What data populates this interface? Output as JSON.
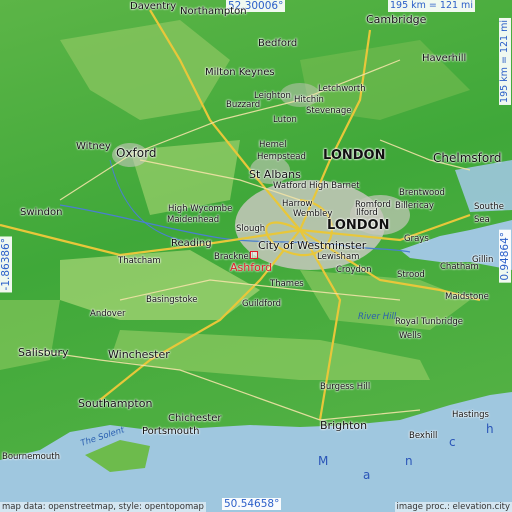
{
  "coords": {
    "top_lat": "52.30006°",
    "bottom_lat": "50.54658°",
    "left_lon": "-1.86386°",
    "right_lon": "0.94864°"
  },
  "scale": {
    "top": "195 km = 121 mi",
    "right": "195 km = 121 mi"
  },
  "credits": {
    "left": "map data: openstreetmap, style: opentopomap",
    "right": "image proc.: elevation.city"
  },
  "marker_label": "Ashford",
  "big_label": "LONDON",
  "cities": {
    "daventry": "Daventry",
    "northampton": "Northampton",
    "cambridge": "Cambridge",
    "bedford": "Bedford",
    "haverhill": "Haverhill",
    "milton_keynes": "Milton Keynes",
    "buzzard": "Buzzard",
    "letchworth": "Letchworth",
    "hitchin": "Hitchin",
    "leighton": "Leighton",
    "stevenage": "Stevenage",
    "luton": "Luton",
    "witney": "Witney",
    "oxford": "Oxford",
    "hemel": "Hemel",
    "hempstead": "Hempstead",
    "chelmsford": "Chelmsford",
    "st_albans": "St Albans",
    "watford": "Watford",
    "high_barnet": "High Barnet",
    "brentwood": "Brentwood",
    "high_wycombe": "High Wycombe",
    "harrow": "Harrow",
    "romford": "Romford",
    "billericay": "Billericay",
    "southend": "Southe",
    "swindon": "Swindon",
    "maidenhead": "Maidenhead",
    "wembley": "Wembley",
    "ilford": "Ilford",
    "sea_label": "Sea",
    "slough": "Slough",
    "reading": "Reading",
    "city_westminster": "City of Westminster",
    "grays": "Grays",
    "thatcham": "Thatcham",
    "bracknell": "Bracknell",
    "lewisham": "Lewisham",
    "croydon": "Croydon",
    "gillingham": "Gillin",
    "strood": "Strood",
    "chatham": "Chatham",
    "thames": "Thames",
    "basingstoke": "Basingstoke",
    "maidstone": "Maidstone",
    "andover": "Andover",
    "guildford": "Guildford",
    "royal_tunbridge": "Royal Tunbridge",
    "river_hill": "River Hill",
    "salisbury": "Salisbury",
    "winchester": "Winchester",
    "wells": "Wells",
    "burgess_hill": "Burgess Hill",
    "southampton": "Southampton",
    "hastings": "Hastings",
    "chichester": "Chichester",
    "portsmouth": "Portsmouth",
    "brighton": "Brighton",
    "bexhill": "Bexhill",
    "bournemouth": "Bournemouth",
    "the_solent": "The Solent"
  },
  "channel_letters": [
    "M",
    "a",
    "n",
    "c",
    "h"
  ],
  "colors": {
    "sea": "#9fc7df",
    "lowland": "#3ea83a",
    "upland": "#8cc863",
    "urban": "#c9c9c0",
    "motorway": "#e8c73a",
    "coord_text": "#2b5fc9",
    "marker": "#e0202a"
  }
}
